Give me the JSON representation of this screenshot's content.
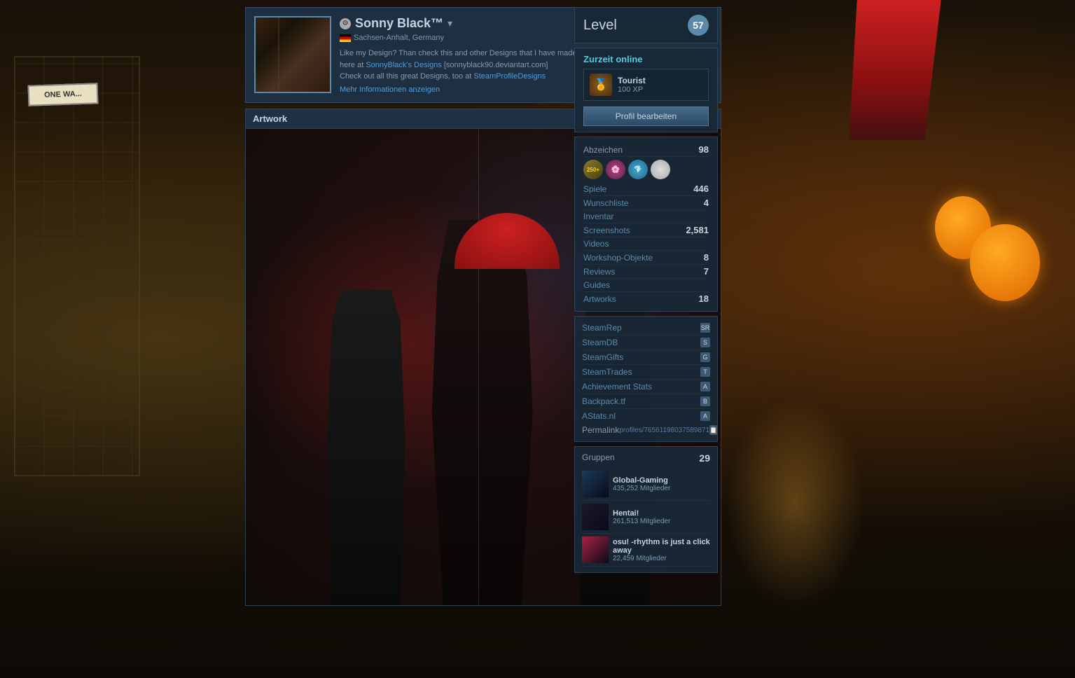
{
  "background": {
    "description": "Asian alley rainy night scene with anime artwork"
  },
  "profile": {
    "name": "Sonny Black™",
    "location": "Sachsen-Anhalt, Germany",
    "bio_line1": "Like my Design? Than check this and other Designs that I have made",
    "bio_line2": "here at ",
    "bio_link1": "SonnyBlack's Designs",
    "bio_link1_url": "[sonnyblack90.deviantart.com]",
    "bio_line3": "Check out all this great Designs, too at ",
    "bio_link2": "SteamProfileDesigns",
    "mehr_text": "Mehr Informationen anzeigen",
    "edit_btn": "Profil bearbeiten"
  },
  "level": {
    "label": "Level",
    "value": "57"
  },
  "status": {
    "label": "Zurzeit online"
  },
  "badge": {
    "name": "Tourist",
    "xp": "100 XP"
  },
  "badges": {
    "label": "Abzeichen",
    "count": "98",
    "items": [
      "250+",
      "🌸",
      "💎",
      "⬜"
    ]
  },
  "stats": [
    {
      "label": "Spiele",
      "value": "446"
    },
    {
      "label": "Wunschliste",
      "value": "4"
    },
    {
      "label": "Inventar",
      "value": ""
    },
    {
      "label": "Screenshots",
      "value": "2,581"
    },
    {
      "label": "Videos",
      "value": ""
    },
    {
      "label": "Workshop-Objekte",
      "value": "8"
    },
    {
      "label": "Reviews",
      "value": "7"
    },
    {
      "label": "Guides",
      "value": ""
    },
    {
      "label": "Artworks",
      "value": "18"
    }
  ],
  "links": [
    {
      "label": "SteamRep",
      "icon": "SR"
    },
    {
      "label": "SteamDB",
      "icon": "S"
    },
    {
      "label": "SteamGifts",
      "icon": "G"
    },
    {
      "label": "SteamTrades",
      "icon": "T"
    },
    {
      "label": "Achievement Stats",
      "icon": "A"
    },
    {
      "label": "Backpack.tf",
      "icon": "B"
    },
    {
      "label": "AStats.nl",
      "icon": "A"
    }
  ],
  "permalink": {
    "label": "Permalink",
    "value": "profiles/76561198037589871"
  },
  "groups": {
    "label": "Gruppen",
    "count": "29",
    "items": [
      {
        "name": "Global-Gaming",
        "members": "435,252 Mitglieder",
        "color": "#1a3a5a"
      },
      {
        "name": "Hentai!",
        "members": "261,513 Mitglieder",
        "color": "#1a1a2a"
      },
      {
        "name": "osu! -rhythm is just a click away",
        "members": "22,459 Mitglieder",
        "color": "#aa2244"
      }
    ]
  },
  "artwork": {
    "section_label": "Artwork"
  },
  "sign": {
    "text": "ONE WA..."
  }
}
